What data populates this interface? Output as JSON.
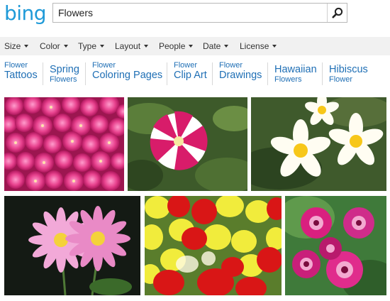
{
  "header": {
    "logo": "bing",
    "search_value": "Flowers",
    "search_icon": "magnifier-icon"
  },
  "filters": [
    {
      "label": "Size"
    },
    {
      "label": "Color"
    },
    {
      "label": "Type"
    },
    {
      "label": "Layout"
    },
    {
      "label": "People"
    },
    {
      "label": "Date"
    },
    {
      "label": "License"
    }
  ],
  "related": [
    {
      "small": "Flower",
      "big": "Tattoos"
    },
    {
      "big": "Spring",
      "small": "Flowers"
    },
    {
      "small": "Flower",
      "big": "Coloring Pages"
    },
    {
      "small": "Flower",
      "big": "Clip Art"
    },
    {
      "small": "Flower",
      "big": "Drawings"
    },
    {
      "big": "Hawaiian",
      "small": "Flowers"
    },
    {
      "big": "Hibiscus",
      "small": "Flower"
    }
  ],
  "colors": {
    "brand": "#1f9ad8",
    "link": "#1f6fb5",
    "filter_bg": "#f1f1f1"
  },
  "images": [
    {
      "name": "pink-chrysanthemums-image"
    },
    {
      "name": "striped-petunia-image"
    },
    {
      "name": "plumeria-image"
    },
    {
      "name": "pink-daisies-image"
    },
    {
      "name": "tulips-image"
    },
    {
      "name": "dianthus-image"
    }
  ]
}
